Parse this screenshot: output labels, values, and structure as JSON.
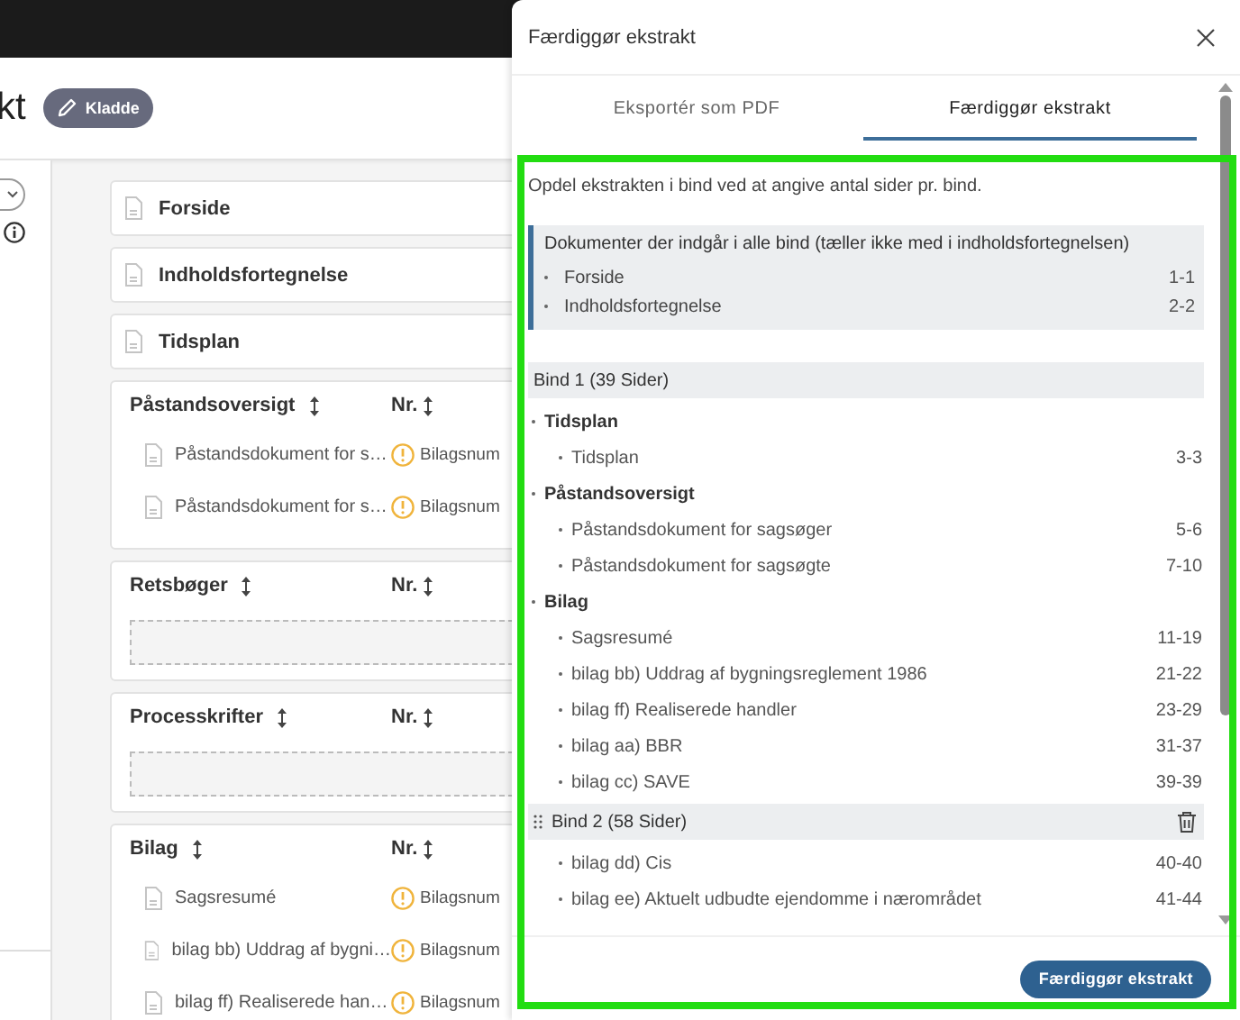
{
  "app": {
    "title": "kt",
    "status_badge": "Kladde",
    "cards": [
      {
        "kind": "document",
        "title": "Forside"
      },
      {
        "kind": "document",
        "title": "Indholdsfortegnelse"
      },
      {
        "kind": "document",
        "title": "Tidsplan"
      },
      {
        "kind": "section",
        "title": "Påstandsoversigt",
        "column_2": "Nr.",
        "rows": [
          {
            "name": "Påstandsdokument for s…",
            "number": "Bilagsnum",
            "warning": true
          },
          {
            "name": "Påstandsdokument for s…",
            "number": "Bilagsnum",
            "warning": true
          }
        ]
      },
      {
        "kind": "section",
        "title": "Retsbøger",
        "column_2": "Nr."
      },
      {
        "kind": "section",
        "title": "Processkrifter",
        "column_2": "Nr."
      },
      {
        "kind": "section",
        "title": "Bilag",
        "column_2": "Nr.",
        "rows": [
          {
            "name": "Sagsresumé",
            "number": "Bilagsnum",
            "warning": true
          },
          {
            "name": "bilag bb) Uddrag af bygni…",
            "number": "Bilagsnum",
            "warning": true
          },
          {
            "name": "bilag ff) Realiserede han…",
            "number": "Bilagsnum",
            "warning": true
          }
        ]
      }
    ]
  },
  "dialog": {
    "title": "Færdiggør ekstrakt",
    "tabs": [
      {
        "label": "Eksportér som PDF",
        "selected": false
      },
      {
        "label": "Færdiggør ekstrakt",
        "selected": true
      }
    ],
    "intro": "Opdel ekstrakten i bind ved at angive antal sider pr. bind.",
    "common": {
      "heading": "Dokumenter der indgår i alle bind (tæller ikke med i indholdsfortegnelsen)",
      "items": [
        {
          "name": "Forside",
          "pages": "1-1"
        },
        {
          "name": "Indholdsfortegnelse",
          "pages": "2-2"
        }
      ]
    },
    "volumes": [
      {
        "heading": "Bind 1 (39 Sider)",
        "removable": false,
        "entries": [
          {
            "kind": "group",
            "name": "Tidsplan",
            "children": [
              {
                "name": "Tidsplan",
                "pages": "3-3"
              }
            ]
          },
          {
            "kind": "group",
            "name": "Påstandsoversigt",
            "children": [
              {
                "name": "Påstandsdokument for sagsøger",
                "pages": "5-6"
              },
              {
                "name": "Påstandsdokument for sagsøgte",
                "pages": "7-10"
              }
            ]
          },
          {
            "kind": "group",
            "name": "Bilag",
            "children": [
              {
                "name": "Sagsresumé",
                "pages": "11-19"
              },
              {
                "name": "bilag bb) Uddrag af bygningsreglement 1986",
                "pages": "21-22"
              },
              {
                "name": "bilag ff) Realiserede handler",
                "pages": "23-29"
              },
              {
                "name": "bilag aa) BBR",
                "pages": "31-37"
              },
              {
                "name": "bilag cc) SAVE",
                "pages": "39-39"
              }
            ]
          }
        ]
      },
      {
        "heading": "Bind 2 (58 Sider)",
        "removable": true,
        "entries": [
          {
            "kind": "item",
            "name": "bilag dd) Cis",
            "pages": "40-40"
          },
          {
            "kind": "item",
            "name": "bilag ee) Aktuelt udbudte ejendomme i nærområdet",
            "pages": "41-44"
          }
        ]
      }
    ],
    "primary_button": "Færdiggør ekstrakt"
  }
}
